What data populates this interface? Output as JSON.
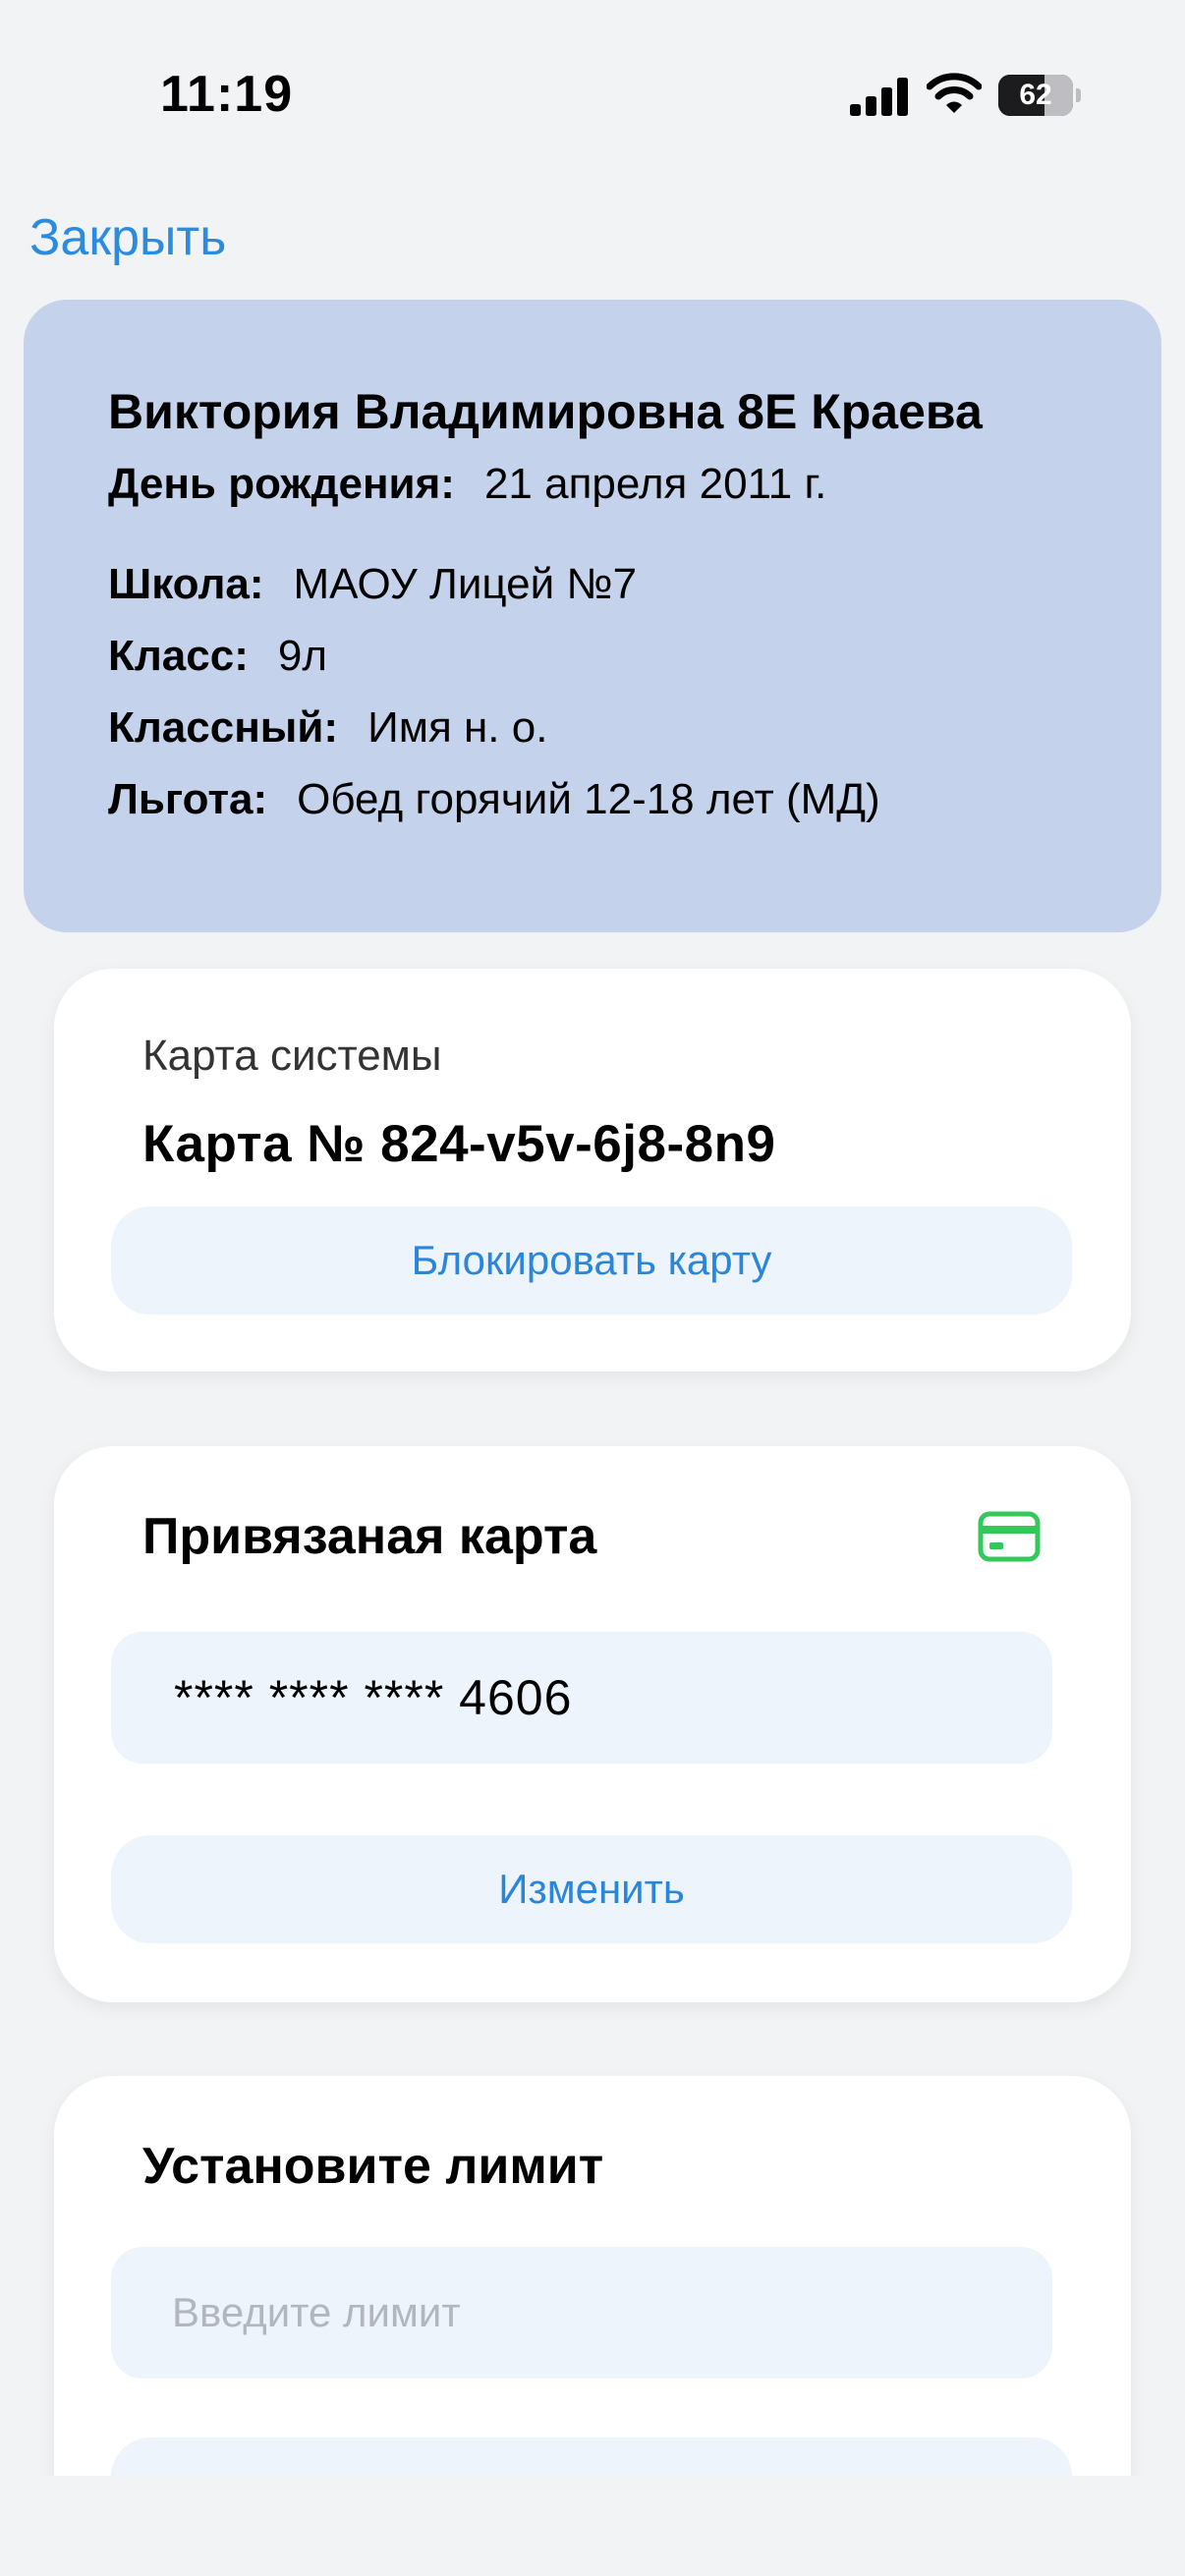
{
  "status_bar": {
    "time": "11:19",
    "battery_percent": 62,
    "battery_label": "62"
  },
  "nav": {
    "close_label": "Закрыть"
  },
  "profile": {
    "name": "Виктория Владимировна 8Е Краева",
    "birthday_label": "День рождения:",
    "birthday_value": "21 апреля 2011 г.",
    "school_label": "Школа:",
    "school_value": "МАОУ Лицей №7",
    "class_label": "Класс:",
    "class_value": "9л",
    "teacher_label": "Классный:",
    "teacher_value": "Имя н. о.",
    "benefit_label": "Льгота:",
    "benefit_value": "Обед горячий 12-18 лет (МД)"
  },
  "system_card": {
    "subtitle": "Карта системы",
    "number": "Карта № 824-v5v-6j8-8n9",
    "block_button": "Блокировать карту"
  },
  "linked_card": {
    "title": "Привязаная карта",
    "masked_number": "**** **** **** 4606",
    "change_button": "Изменить"
  },
  "limit": {
    "title": "Установите лимит",
    "input_placeholder": "Введите лимит",
    "input_value": ""
  },
  "colors": {
    "accent": "#2b8bde",
    "profile_bg": "#c4d2ec",
    "card_icon": "#35c759",
    "field_bg": "#eef4fc"
  }
}
